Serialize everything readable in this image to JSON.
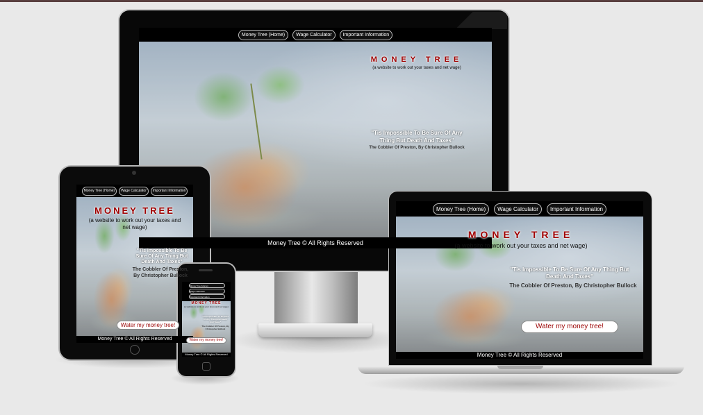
{
  "site": {
    "nav": [
      "Money Tree (Home)",
      "Wage Calculator",
      "Important Information"
    ],
    "nav_phone": [
      "Money Tree (Home)",
      "Wage Calculator",
      "Important Information"
    ],
    "title": "MONEY TREE",
    "subtitle": "(a website to work out your taxes and net wage)",
    "quote": "\"Tis Impossible To Be Sure Of Any Thing But Death And Taxes\"",
    "author": "The Cobbler Of Preston, By Christopher Bullock",
    "cta": "Water my money tree!",
    "footer": "Money Tree © All Rights Reserved"
  },
  "colors": {
    "brand_red": "#a00000",
    "background": "#e9e9e9",
    "bezel": "#0a0a0a"
  }
}
